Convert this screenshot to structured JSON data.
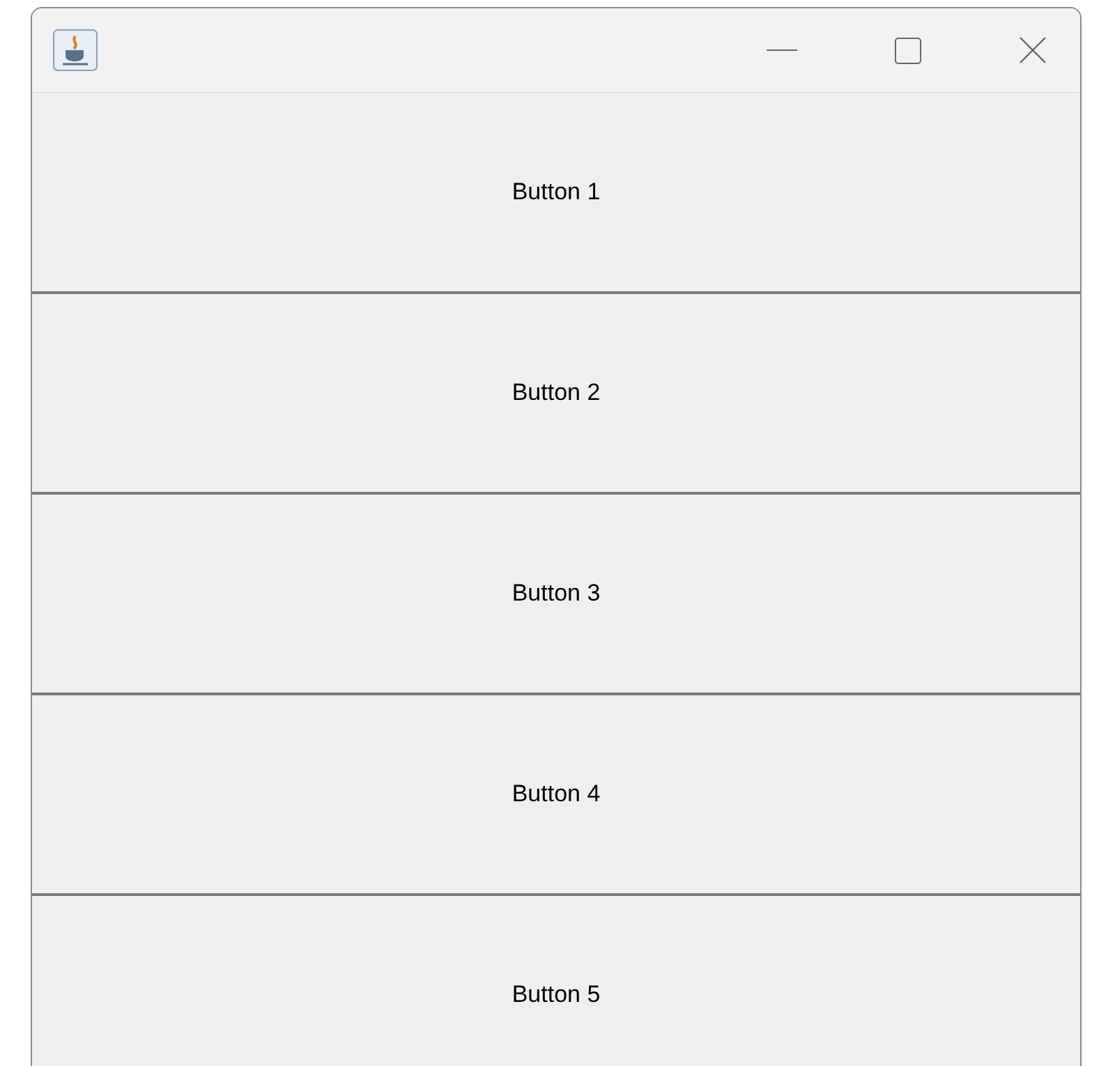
{
  "buttons": [
    {
      "label": "Button 1"
    },
    {
      "label": "Button 2"
    },
    {
      "label": "Button 3"
    },
    {
      "label": "Button 4"
    },
    {
      "label": "Button 5"
    }
  ]
}
